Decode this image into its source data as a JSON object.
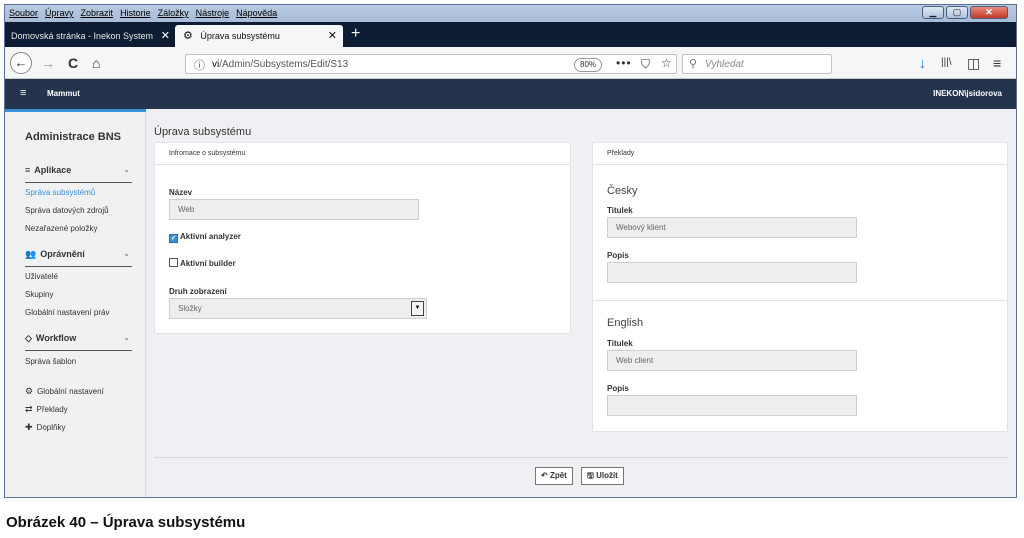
{
  "browser": {
    "menu": [
      "Soubor",
      "Úpravy",
      "Zobrazit",
      "Historie",
      "Záložky",
      "Nástroje",
      "Nápověda"
    ],
    "window_buttons": {
      "minimize": "▁",
      "maximize": "▢",
      "close": "✕"
    },
    "tabs": [
      {
        "label": "Domovská stránka - Inekon System",
        "close": "✕"
      },
      {
        "label": "Úprava subsystému",
        "close": "✕"
      }
    ],
    "new_tab": "+",
    "back": "←",
    "forward": "→",
    "reload": "C",
    "home": "⌂",
    "url_prefix": "vi",
    "url_path": "/Admin/Subsystems/Edit/S13",
    "zoom": "80%",
    "page_actions": "•••",
    "search_placeholder": "Vyhledat",
    "right_icons": {
      "download": "↓",
      "library": "|||\\",
      "sidebar": "◫",
      "menu": "≡"
    }
  },
  "app": {
    "burger": "≡",
    "name": "Mammut",
    "user": "INEKON\\jsidorova"
  },
  "sidebar": {
    "title": "Administrace BNS",
    "sections": [
      {
        "label": "Aplikace",
        "icon": "≡",
        "items": [
          "Správa subsystémů",
          "Správa datových zdrojů",
          "Nezařazené položky"
        ]
      },
      {
        "label": "Oprávnění",
        "icon": "👥",
        "items": [
          "Uživatelé",
          "Skupiny",
          "Globální nastavení práv"
        ]
      },
      {
        "label": "Workflow",
        "icon": "◇",
        "items": [
          "Správa šablon"
        ]
      }
    ],
    "chevron": "⌄",
    "bottom_items": [
      {
        "label": "Globální nastavení",
        "icon": "⚙"
      },
      {
        "label": "Překlady",
        "icon": "⇄"
      },
      {
        "label": "Doplňky",
        "icon": "✚"
      }
    ]
  },
  "main": {
    "page_title": "Úprava subsystému",
    "info_panel": {
      "header": "Infromace o subsystému",
      "name_label": "Název",
      "name_value": "Web",
      "active_analyzer_label": "Aktivní analyzer",
      "active_analyzer_checked": true,
      "active_builder_label": "Aktivní builder",
      "active_builder_checked": false,
      "display_type_label": "Druh zobrazení",
      "display_type_value": "Složky",
      "select_arrow": "▼",
      "check_mark": "✓"
    },
    "translations_panel": {
      "header": "Překlady",
      "languages": [
        {
          "name": "Česky",
          "title_label": "Titulek",
          "title_value": "Webový klient",
          "desc_label": "Popis",
          "desc_value": ""
        },
        {
          "name": "English",
          "title_label": "Titulek",
          "title_value": "Web client",
          "desc_label": "Popis",
          "desc_value": ""
        }
      ]
    },
    "buttons": {
      "back_icon": "↶",
      "back_label": "Zpět",
      "save_icon": "🖫",
      "save_label": "Uložit"
    }
  },
  "caption": "Obrázek 40 – Úprava subsystému"
}
